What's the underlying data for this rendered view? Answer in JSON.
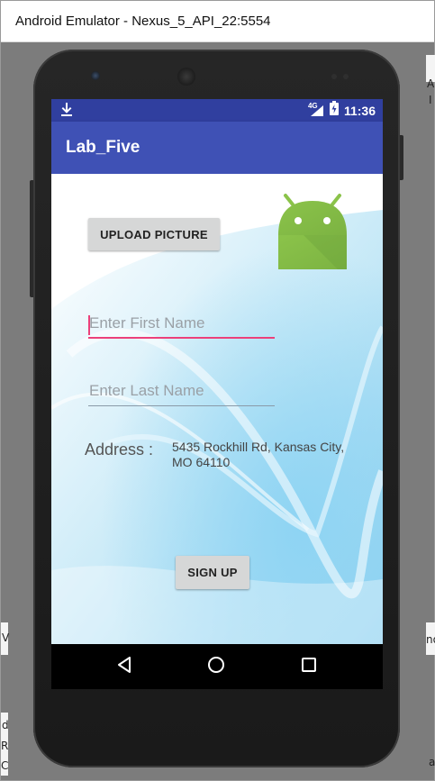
{
  "window": {
    "title": "Android Emulator - Nexus_5_API_22:5554"
  },
  "statusbar": {
    "time": "11:36",
    "network": "4G"
  },
  "app": {
    "title": "Lab_Five"
  },
  "form": {
    "upload_label": "UPLOAD PICTURE",
    "first_name_placeholder": "Enter First Name",
    "last_name_placeholder": "Enter Last Name",
    "address_label": "Address :",
    "address_value": "5435 Rockhill Rd, Kansas City, MO 64110",
    "signup_label": "SIGN UP"
  },
  "background_peek": {
    "right_1": "An",
    "right_2": "I",
    "right_3": "no",
    "left_1": "d",
    "left_2": "R",
    "left_3": "C",
    "left_4": "V",
    "right_4": "a"
  },
  "colors": {
    "status_bar": "#303f9f",
    "toolbar": "#3f51b5",
    "accent": "#ec407a",
    "android_green": "#8bc34a"
  }
}
